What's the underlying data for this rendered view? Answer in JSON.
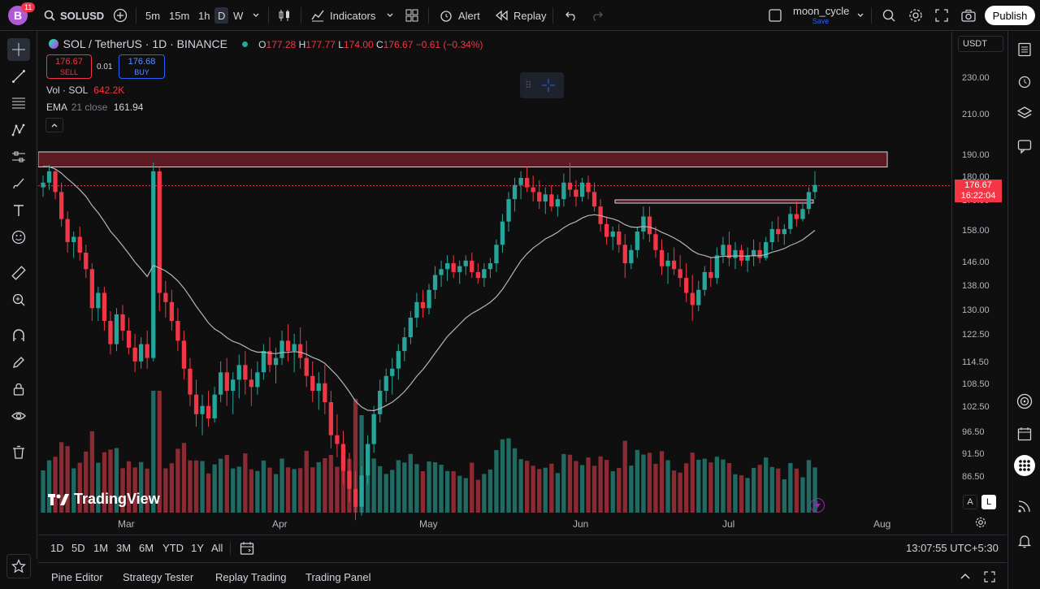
{
  "topbar": {
    "avatar_letter": "B",
    "notification_count": "11",
    "symbol": "SOLUSD",
    "timeframes": [
      "5m",
      "15m",
      "1h",
      "D",
      "W"
    ],
    "indicators_label": "Indicators",
    "alert_label": "Alert",
    "replay_label": "Replay",
    "layout_name": "moon_cycle",
    "layout_status": "Save",
    "publish_label": "Publish"
  },
  "legend": {
    "pair": "SOL / TetherUS · 1D · BINANCE",
    "open_label": "O",
    "open": "177.28",
    "high_label": "H",
    "high": "177.77",
    "low_label": "L",
    "low": "174.00",
    "close_label": "C",
    "close": "176.67",
    "change": "−0.61 (−0.34%)",
    "sell_price": "176.67",
    "sell_label": "SELL",
    "spread": "0.01",
    "buy_price": "176.68",
    "buy_label": "BUY",
    "vol_label": "Vol · SOL",
    "vol_value": "642.2K",
    "ema_label": "EMA",
    "ema_params": "21 close",
    "ema_value": "161.94"
  },
  "price_scale": {
    "currency": "USDT",
    "labels": [
      "230.00",
      "210.00",
      "190.00",
      "180.00",
      "170.00",
      "158.00",
      "146.00",
      "138.00",
      "130.00",
      "122.50",
      "114.50",
      "108.50",
      "102.50",
      "96.50",
      "91.50",
      "86.50"
    ],
    "current_price": "176.67",
    "countdown": "16:22:04",
    "scale_mode_a": "A",
    "scale_mode_l": "L"
  },
  "time_axis": [
    "Mar",
    "Apr",
    "May",
    "Jun",
    "Jul",
    "Aug"
  ],
  "watermark": "TradingView",
  "range_bar": {
    "ranges": [
      "1D",
      "5D",
      "1M",
      "3M",
      "6M",
      "YTD",
      "1Y",
      "All"
    ],
    "clock": "13:07:55 UTC+5:30"
  },
  "bottom_tabs": [
    "Pine Editor",
    "Strategy Tester",
    "Replay Trading",
    "Trading Panel"
  ],
  "colors": {
    "up": "#26a69a",
    "down": "#f23645",
    "ema": "#b2b5be",
    "zone": "#5c1a22"
  },
  "chart_data": {
    "type": "candlestick",
    "candles": [
      [
        176,
        181,
        172,
        178
      ],
      [
        178,
        186,
        175,
        183
      ],
      [
        183,
        184,
        171,
        174
      ],
      [
        174,
        178,
        160,
        163
      ],
      [
        163,
        166,
        150,
        154
      ],
      [
        154,
        158,
        148,
        156
      ],
      [
        156,
        160,
        147,
        150
      ],
      [
        150,
        153,
        141,
        144
      ],
      [
        144,
        146,
        127,
        131
      ],
      [
        131,
        138,
        127,
        136
      ],
      [
        136,
        138,
        124,
        127
      ],
      [
        127,
        130,
        117,
        120
      ],
      [
        120,
        131,
        118,
        129
      ],
      [
        129,
        132,
        121,
        124
      ],
      [
        124,
        128,
        117,
        119
      ],
      [
        119,
        123,
        112,
        115
      ],
      [
        115,
        122,
        113,
        120
      ],
      [
        120,
        124,
        113,
        116
      ],
      [
        116,
        187,
        115,
        183
      ],
      [
        183,
        185,
        130,
        136
      ],
      [
        136,
        140,
        128,
        133
      ],
      [
        133,
        137,
        124,
        127
      ],
      [
        127,
        131,
        118,
        121
      ],
      [
        121,
        124,
        110,
        113
      ],
      [
        113,
        116,
        103,
        106
      ],
      [
        106,
        110,
        98,
        101
      ],
      [
        101,
        106,
        96,
        103
      ],
      [
        103,
        107,
        98,
        100
      ],
      [
        100,
        108,
        99,
        106
      ],
      [
        106,
        115,
        104,
        112
      ],
      [
        112,
        116,
        103,
        107
      ],
      [
        107,
        112,
        101,
        110
      ],
      [
        110,
        117,
        105,
        114
      ],
      [
        114,
        118,
        106,
        110
      ],
      [
        110,
        113,
        103,
        108
      ],
      [
        108,
        115,
        106,
        112
      ],
      [
        112,
        120,
        110,
        118
      ],
      [
        118,
        122,
        112,
        114
      ],
      [
        114,
        119,
        109,
        116
      ],
      [
        116,
        124,
        114,
        121
      ],
      [
        121,
        126,
        115,
        118
      ],
      [
        118,
        123,
        112,
        120
      ],
      [
        120,
        125,
        113,
        116
      ],
      [
        116,
        121,
        108,
        111
      ],
      [
        111,
        115,
        104,
        107
      ],
      [
        107,
        112,
        102,
        109
      ],
      [
        109,
        114,
        101,
        104
      ],
      [
        104,
        107,
        93,
        96
      ],
      [
        96,
        101,
        91,
        94
      ],
      [
        94,
        97,
        85,
        88
      ],
      [
        88,
        92,
        81,
        84
      ],
      [
        84,
        88,
        77,
        80
      ],
      [
        80,
        89,
        78,
        87
      ],
      [
        87,
        96,
        85,
        94
      ],
      [
        94,
        103,
        92,
        101
      ],
      [
        101,
        110,
        99,
        107
      ],
      [
        107,
        113,
        104,
        111
      ],
      [
        111,
        116,
        106,
        113
      ],
      [
        113,
        120,
        110,
        118
      ],
      [
        118,
        125,
        115,
        122
      ],
      [
        122,
        130,
        120,
        128
      ],
      [
        128,
        136,
        125,
        133
      ],
      [
        133,
        137,
        128,
        131
      ],
      [
        131,
        139,
        129,
        137
      ],
      [
        137,
        145,
        134,
        142
      ],
      [
        142,
        147,
        138,
        144
      ],
      [
        144,
        149,
        140,
        146
      ],
      [
        146,
        149,
        141,
        143
      ],
      [
        143,
        147,
        139,
        145
      ],
      [
        145,
        149,
        142,
        147
      ],
      [
        147,
        150,
        141,
        143
      ],
      [
        143,
        146,
        139,
        141
      ],
      [
        141,
        146,
        138,
        144
      ],
      [
        144,
        148,
        141,
        146
      ],
      [
        146,
        155,
        143,
        153
      ],
      [
        153,
        165,
        150,
        162
      ],
      [
        162,
        174,
        158,
        171
      ],
      [
        171,
        180,
        166,
        177
      ],
      [
        177,
        183,
        171,
        180
      ],
      [
        180,
        185,
        174,
        176
      ],
      [
        176,
        181,
        170,
        174
      ],
      [
        174,
        179,
        167,
        170
      ],
      [
        170,
        176,
        165,
        173
      ],
      [
        173,
        177,
        166,
        168
      ],
      [
        168,
        173,
        164,
        171
      ],
      [
        171,
        182,
        168,
        178
      ],
      [
        178,
        187,
        172,
        175
      ],
      [
        175,
        179,
        168,
        172
      ],
      [
        172,
        180,
        170,
        178
      ],
      [
        178,
        181,
        171,
        174
      ],
      [
        174,
        178,
        166,
        168
      ],
      [
        168,
        171,
        158,
        161
      ],
      [
        161,
        164,
        153,
        156
      ],
      [
        156,
        160,
        151,
        158
      ],
      [
        158,
        161,
        150,
        153
      ],
      [
        153,
        157,
        141,
        146
      ],
      [
        146,
        153,
        144,
        151
      ],
      [
        151,
        160,
        148,
        158
      ],
      [
        158,
        168,
        155,
        164
      ],
      [
        164,
        168,
        154,
        157
      ],
      [
        157,
        160,
        148,
        151
      ],
      [
        151,
        155,
        142,
        145
      ],
      [
        145,
        150,
        139,
        147
      ],
      [
        147,
        152,
        142,
        144
      ],
      [
        144,
        149,
        138,
        141
      ],
      [
        141,
        146,
        133,
        136
      ],
      [
        136,
        142,
        127,
        132
      ],
      [
        132,
        140,
        130,
        137
      ],
      [
        137,
        145,
        135,
        143
      ],
      [
        143,
        148,
        138,
        141
      ],
      [
        141,
        152,
        139,
        149
      ],
      [
        149,
        156,
        146,
        153
      ],
      [
        153,
        158,
        145,
        148
      ],
      [
        148,
        154,
        144,
        151
      ],
      [
        151,
        153,
        145,
        147
      ],
      [
        147,
        152,
        143,
        149
      ],
      [
        149,
        155,
        145,
        151
      ],
      [
        151,
        154,
        146,
        148
      ],
      [
        148,
        156,
        147,
        154
      ],
      [
        154,
        162,
        151,
        159
      ],
      [
        159,
        164,
        154,
        157
      ],
      [
        157,
        161,
        153,
        159
      ],
      [
        159,
        168,
        157,
        165
      ],
      [
        165,
        170,
        160,
        163
      ],
      [
        163,
        169,
        162,
        167
      ],
      [
        167,
        176,
        165,
        174
      ],
      [
        174,
        183,
        171,
        177
      ]
    ],
    "resistance_zone": [
      185,
      192
    ],
    "support_line": 170,
    "current_price": 176.67
  }
}
